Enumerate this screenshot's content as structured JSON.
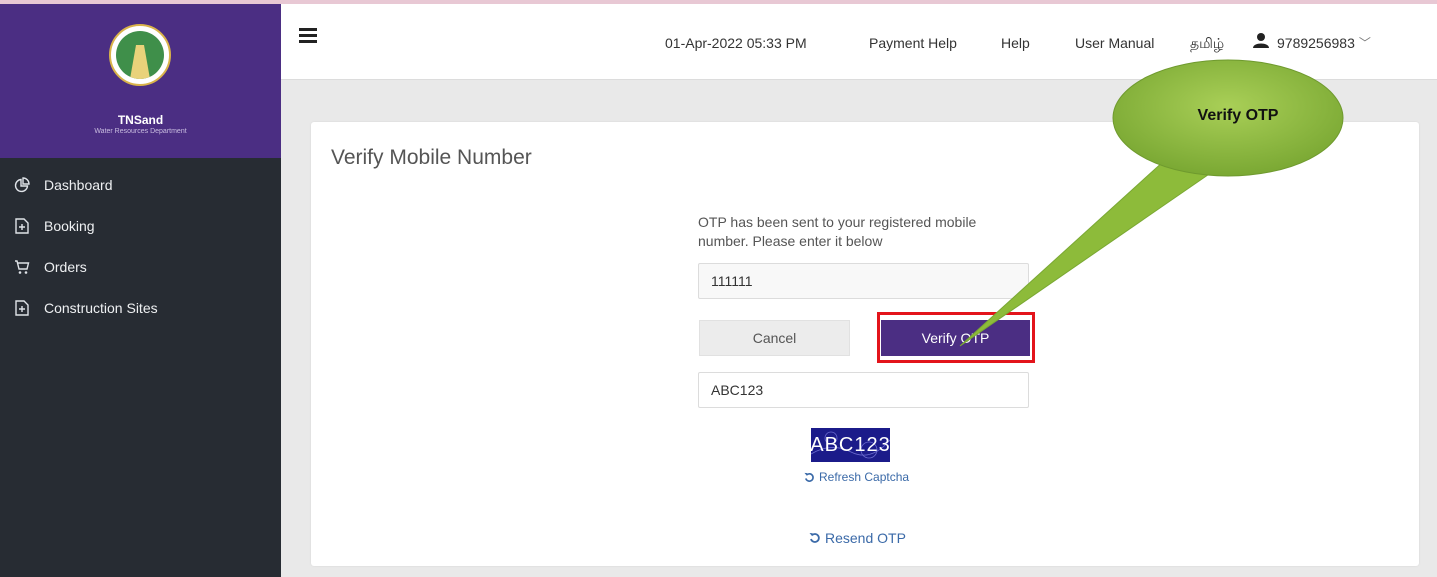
{
  "sidebar": {
    "brand": "TNSand",
    "brand_sub": "Water Resources Department",
    "items": [
      {
        "label": "Dashboard",
        "icon": "pie-chart-icon"
      },
      {
        "label": "Booking",
        "icon": "file-plus-icon"
      },
      {
        "label": "Orders",
        "icon": "cart-icon"
      },
      {
        "label": "Construction Sites",
        "icon": "file-plus-icon"
      }
    ]
  },
  "header": {
    "datetime": "01-Apr-2022 05:33 PM",
    "payment_help": "Payment Help",
    "help": "Help",
    "user_manual": "User Manual",
    "language": "தமிழ்",
    "user": "9789256983"
  },
  "card": {
    "title": "Verify Mobile Number",
    "message": "OTP has been sent to your registered mobile number. Please enter it below",
    "otp_value": "111111",
    "cancel_label": "Cancel",
    "verify_label": "Verify OTP",
    "captcha_value": "ABC123",
    "captcha_text": "ABC123",
    "refresh_label": "Refresh Captcha",
    "resend_label": "Resend OTP"
  },
  "callout": {
    "label": "Verify OTP"
  },
  "colors": {
    "brand_purple": "#4b2e83",
    "sidebar_dark": "#272c33",
    "highlight_red": "#e3141b",
    "callout_green": "#8dbb3a",
    "link_blue": "#3b6aa8"
  }
}
